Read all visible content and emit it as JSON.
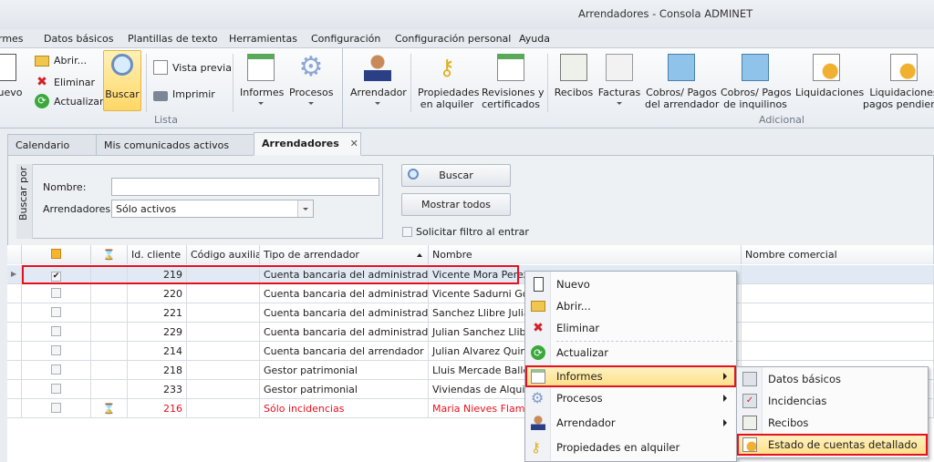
{
  "window": {
    "title": "Arrendadores - Consola ADMINET"
  },
  "menubar": [
    "rmes",
    "Datos básicos",
    "Plantillas de texto",
    "Herramientas",
    "Configuración",
    "Configuración personal",
    "Ayuda"
  ],
  "ribbon": {
    "nuevo": "uevo",
    "abrir": "Abrir...",
    "eliminar": "Eliminar",
    "actualizar": "Actualizar",
    "buscar": "Buscar",
    "vista_previa": "Vista previa",
    "imprimir": "Imprimir",
    "informes": "Informes",
    "procesos": "Procesos",
    "group_lista": "Lista",
    "arrendador": "Arrendador",
    "propiedades_1": "Propiedades",
    "propiedades_2": "en alquiler",
    "revisiones_1": "Revisiones y",
    "revisiones_2": "certificados",
    "recibos": "Recibos",
    "facturas": "Facturas",
    "cobros_arr_1": "Cobros/ Pagos",
    "cobros_arr_2": "del arrendador",
    "cobros_inq_1": "Cobros/ Pagos",
    "cobros_inq_2": "de inquilinos",
    "liquidaciones": "Liquidaciones",
    "liq_pend_1": "Liquidaciones",
    "liq_pend_2": "pagos pendientes",
    "group_adicional": "Adicional"
  },
  "tabs": [
    {
      "label": "Calendario"
    },
    {
      "label": "Mis comunicados activos"
    },
    {
      "label": "Arrendadores",
      "close": "✕"
    }
  ],
  "search": {
    "group_label": "Buscar por",
    "nombre_label": "Nombre:",
    "nombre_value": "",
    "arrendadores_label": "Arrendadores:",
    "arrendadores_value": "Sólo activos",
    "buscar_button": "Buscar",
    "mostrar_todos": "Mostrar todos",
    "solicitar_filtro": "Solicitar filtro al entrar"
  },
  "grid": {
    "columns": [
      "",
      "",
      "Id. cliente",
      "Código auxiliar",
      "Tipo de arrendador",
      "Nombre",
      "Nombre comercial"
    ],
    "rows": [
      {
        "checked": true,
        "pending": false,
        "id": "219",
        "codigo": "",
        "tipo": "Cuenta bancaria del administrador",
        "nombre": "Vicente Mora Perez",
        "comercial": ""
      },
      {
        "checked": false,
        "pending": false,
        "id": "220",
        "codigo": "",
        "tipo": "Cuenta bancaria del administrador",
        "nombre": "Vicente Sadurni Gonz",
        "comercial": ""
      },
      {
        "checked": false,
        "pending": false,
        "id": "221",
        "codigo": "",
        "tipo": "Cuenta bancaria del administrador",
        "nombre": "Sanchez Llibre Julian",
        "comercial": ""
      },
      {
        "checked": false,
        "pending": false,
        "id": "229",
        "codigo": "",
        "tipo": "Cuenta bancaria del administrador",
        "nombre": "Julian Sanchez Llibre",
        "comercial": ""
      },
      {
        "checked": false,
        "pending": false,
        "id": "214",
        "codigo": "",
        "tipo": "Cuenta bancaria del arrendador",
        "nombre": "Julian Alvarez Quinte",
        "comercial": ""
      },
      {
        "checked": false,
        "pending": false,
        "id": "218",
        "codigo": "",
        "tipo": "Gestor patrimonial",
        "nombre": "Lluis Mercade Ballest",
        "comercial": ""
      },
      {
        "checked": false,
        "pending": false,
        "id": "233",
        "codigo": "",
        "tipo": "Gestor patrimonial",
        "nombre": "Viviendas de Alquiler,",
        "comercial": ""
      },
      {
        "checked": false,
        "pending": true,
        "id": "216",
        "codigo": "",
        "tipo": "Sólo incidencias",
        "nombre": "Maria Nieves Flameric",
        "comercial": ""
      }
    ]
  },
  "context_menu": {
    "items": [
      "Nuevo",
      "Abrir...",
      "Eliminar",
      "Actualizar",
      "Informes",
      "Procesos",
      "Arrendador",
      "Propiedades en alquiler"
    ]
  },
  "submenu": {
    "items": [
      "Datos básicos",
      "Incidencias",
      "Recibos",
      "Estado de cuentas detallado"
    ]
  },
  "colors": {
    "highlight": "#fddf85",
    "alert_red": "#e8101c"
  }
}
